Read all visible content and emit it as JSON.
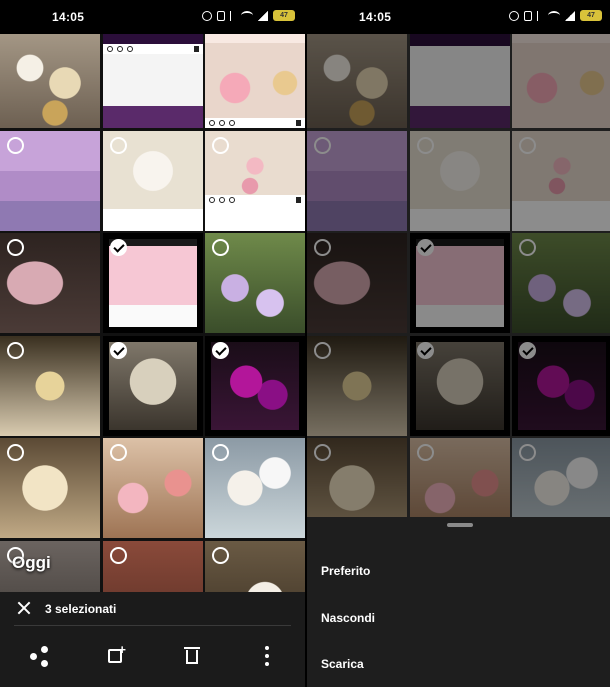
{
  "status": {
    "time": "14:05",
    "battery": "47"
  },
  "gallery": {
    "section_label": "Oggi",
    "tiles": [
      {
        "id": 1,
        "selectable": false,
        "selected": false
      },
      {
        "id": 2,
        "selectable": false,
        "selected": false
      },
      {
        "id": 3,
        "selectable": false,
        "selected": false
      },
      {
        "id": 4,
        "selectable": true,
        "selected": false
      },
      {
        "id": 5,
        "selectable": true,
        "selected": false
      },
      {
        "id": 6,
        "selectable": true,
        "selected": false
      },
      {
        "id": 7,
        "selectable": true,
        "selected": false
      },
      {
        "id": 8,
        "selectable": true,
        "selected": true
      },
      {
        "id": 9,
        "selectable": true,
        "selected": false
      },
      {
        "id": 10,
        "selectable": true,
        "selected": false
      },
      {
        "id": 11,
        "selectable": true,
        "selected": true
      },
      {
        "id": 12,
        "selectable": true,
        "selected": true
      },
      {
        "id": 13,
        "selectable": true,
        "selected": false
      },
      {
        "id": 14,
        "selectable": true,
        "selected": false
      },
      {
        "id": 15,
        "selectable": true,
        "selected": false
      },
      {
        "id": 16,
        "selectable": true,
        "selected": false
      },
      {
        "id": 17,
        "selectable": true,
        "selected": false
      },
      {
        "id": 18,
        "selectable": true,
        "selected": false
      }
    ]
  },
  "selection_bar": {
    "count_label": "3 selezionati",
    "actions": [
      "share-icon",
      "add-to-album-icon",
      "trash-icon",
      "more-vert-icon"
    ]
  },
  "bottom_sheet": {
    "items": [
      "Preferito",
      "Nascondi",
      "Scarica"
    ]
  },
  "colors": {
    "background": "#111111",
    "sheet": "#1e1e1e",
    "battery": "#d8c23a"
  }
}
